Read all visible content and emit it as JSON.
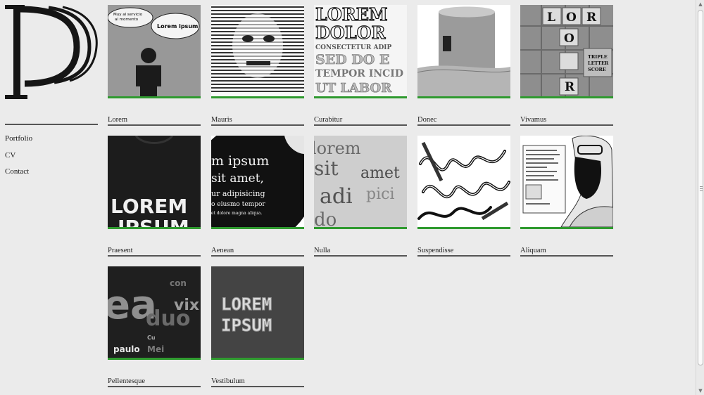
{
  "logo": {
    "letter": "P"
  },
  "nav": [
    {
      "label": "Portfolio"
    },
    {
      "label": "CV"
    },
    {
      "label": "Contact"
    }
  ],
  "tiles": [
    {
      "caption": "Lorem",
      "thumb_text": [
        "Lorem ipsum",
        "Muy al servicio",
        "al momento"
      ]
    },
    {
      "caption": "Mauris"
    },
    {
      "caption": "Curabitur",
      "thumb_text": [
        "LOREM",
        "DOLOR",
        "CONSECTETUR ADIP",
        "SED DO E",
        "TEMPOR INCID",
        "UT LABOR"
      ]
    },
    {
      "caption": "Donec"
    },
    {
      "caption": "Vivamus",
      "thumb_text": [
        "L",
        "O",
        "R",
        "E",
        "TRIPLE",
        "LETTER",
        "SCORE"
      ]
    },
    {
      "caption": "Praesent",
      "thumb_text": [
        "LOREM",
        "IPSUM"
      ]
    },
    {
      "caption": "Aenean",
      "thumb_text": [
        "m ipsum",
        "sit amet,",
        "ur adipisicing",
        "o eiusmo tempor",
        "et dolore magna aliqua."
      ]
    },
    {
      "caption": "Nulla",
      "thumb_text": [
        "lorem",
        "sit",
        "amet",
        "adi",
        "pici",
        "do"
      ]
    },
    {
      "caption": "Suspendisse"
    },
    {
      "caption": "Aliquam"
    },
    {
      "caption": "Pellentesque",
      "thumb_text": [
        "ea",
        "duo",
        "vix",
        "paulo",
        "Mei",
        "Cu",
        "con"
      ]
    },
    {
      "caption": "Vestibulum",
      "thumb_text": [
        "LOREM",
        "IPSUM"
      ]
    }
  ],
  "colors": {
    "accent_green": "#2f9a2f",
    "background": "#ebebeb",
    "rule": "#555555"
  },
  "icons": {
    "scroll_up": "triangle-up",
    "scroll_down": "triangle-down"
  }
}
